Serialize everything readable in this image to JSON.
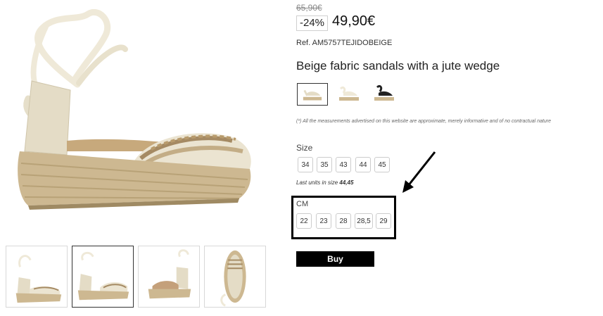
{
  "product": {
    "old_price": "65,90€",
    "discount": "-24%",
    "price": "49,90€",
    "reference": "Ref. AM5757TEJIDOBEIGE",
    "title": "Beige fabric sandals with a jute wedge",
    "disclaimer": "(*) All the measurements advertised on this website are approximate, merely informative and of no contractual nature"
  },
  "colors": [
    {
      "name": "beige-striped",
      "active": true
    },
    {
      "name": "cream"
    },
    {
      "name": "black"
    }
  ],
  "sizes": {
    "label": "Size",
    "options": [
      "34",
      "35",
      "43",
      "44",
      "45"
    ],
    "last_units_prefix": "Last units in size ",
    "last_units_sizes": "44,45"
  },
  "cm": {
    "label": "CM",
    "options": [
      "22",
      "23",
      "28",
      "28,5",
      "29"
    ]
  },
  "buy_label": "Buy",
  "thumbnails": [
    {
      "view": "side-right"
    },
    {
      "view": "side-left",
      "active": true
    },
    {
      "view": "back"
    },
    {
      "view": "top"
    }
  ],
  "colors_theme": {
    "jute": "#c9b48e",
    "canvas": "#e9e2cf",
    "stripe_brown": "#a58a63",
    "ribbon": "#eee8d6",
    "annotation": "#000000"
  }
}
